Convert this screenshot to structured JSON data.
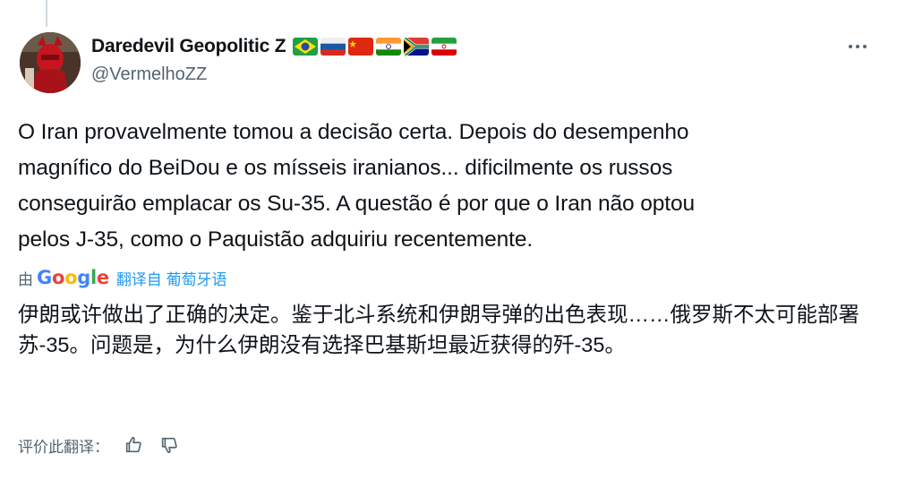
{
  "author": {
    "display_name": "Daredevil Geopolitic Z",
    "handle": "@VermelhoZZ",
    "flags": [
      "brazil-flag-icon",
      "russia-flag-icon",
      "china-flag-icon",
      "india-flag-icon",
      "south-africa-flag-icon",
      "iran-flag-icon"
    ]
  },
  "post": {
    "text": "O Iran provavelmente tomou a decisão certa. Depois do desempenho\nmagnífico do BeiDou e os mísseis iranianos... dificilmente os russos\nconseguirão emplacar os Su-35. A questão é por que o Iran não optou\npelos J-35, como o Paquistão adquiriu recentemente."
  },
  "translation": {
    "by_label": "由",
    "provider": "Google",
    "link_label": "翻译自 葡萄牙语",
    "text": "伊朗或许做出了正确的决定。鉴于北斗系统和伊朗导弹的出色表现……俄罗斯不太可能部署苏-35。问题是，为什么伊朗没有选择巴基斯坦最近获得的歼-35。"
  },
  "rating": {
    "label": "评价此翻译："
  },
  "colors": {
    "link": "#1d9bf0",
    "secondary_text": "#536471",
    "primary_text": "#0f1419"
  }
}
